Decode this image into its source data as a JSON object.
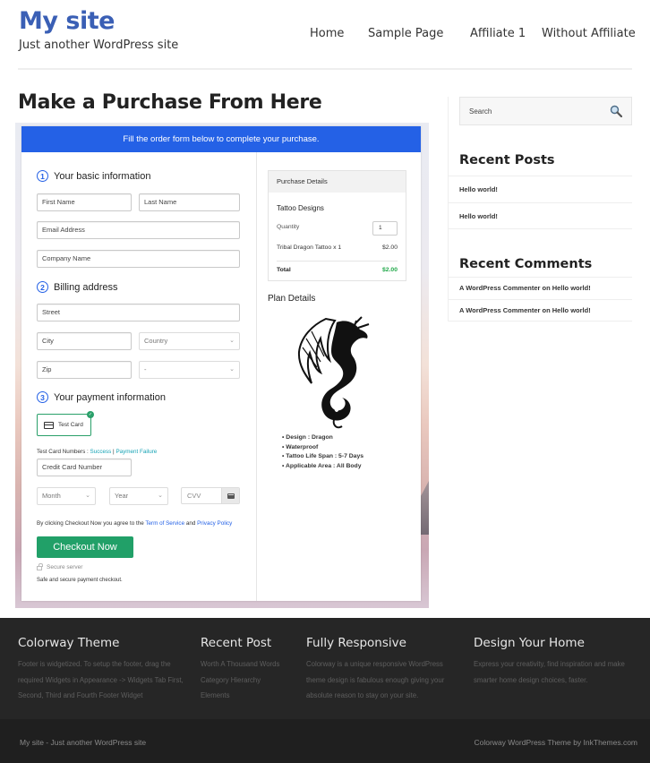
{
  "header": {
    "site_title": "My site",
    "site_description": "Just another WordPress site",
    "nav": [
      "Home",
      "Sample Page",
      "Affiliate 1",
      "Without Affiliate"
    ]
  },
  "page": {
    "title": "Make a Purchase From Here"
  },
  "form": {
    "banner": "Fill the order form below to complete your purchase.",
    "sections": [
      {
        "num": "1",
        "title": "Your basic information"
      },
      {
        "num": "2",
        "title": "Billing address"
      },
      {
        "num": "3",
        "title": "Your payment information"
      }
    ],
    "fields": {
      "first_name": "First Name",
      "last_name": "Last Name",
      "email": "Email Address",
      "company": "Company Name",
      "street": "Street",
      "city": "City",
      "country": "Country",
      "zip": "Zip",
      "state": "-",
      "card_number": "Credit Card Number",
      "month": "Month",
      "year": "Year",
      "cvv": "CVV"
    },
    "payment_method": "Test Card",
    "test_cards_label": "Test Card Numbers : ",
    "test_success": "Success",
    "test_sep": " | ",
    "test_failure": "Payment Failure",
    "agree_prefix": "By clicking Checkout Now you agree to the ",
    "terms": "Term of Service",
    "agree_and": " and ",
    "privacy": "Privacy Policy",
    "checkout_label": "Checkout Now",
    "secure_label": "Secure server",
    "safe_note": "Safe and secure payment checkout."
  },
  "purchase": {
    "heading": "Purchase Details",
    "product_group": "Tattoo Designs",
    "quantity_label": "Quantity",
    "quantity": "1",
    "line_item": "Tribal Dragon Tattoo x 1",
    "line_amount": "$2.00",
    "total_label": "Total",
    "total_amount": "$2.00"
  },
  "plan": {
    "heading": "Plan Details",
    "features": [
      "Design : Dragon",
      "Waterproof",
      "Tattoo Life Span : 5-7 Days",
      "Applicable Area : All Body"
    ]
  },
  "sidebar": {
    "search_placeholder": "Search",
    "recent_posts_title": "Recent Posts",
    "recent_posts": [
      "Hello world!",
      "Hello world!"
    ],
    "recent_comments_title": "Recent Comments",
    "recent_comments": [
      "A WordPress Commenter on Hello world!",
      "A WordPress Commenter on Hello world!"
    ]
  },
  "footer": {
    "columns": [
      {
        "title": "Colorway Theme",
        "text": "Footer is widgetized. To setup the footer, drag the required Widgets in Appearance -> Widgets Tab First, Second, Third and Fourth Footer Widget"
      },
      {
        "title": "Recent Post",
        "links": [
          "Worth A Thousand Words",
          "Category Hierarchy",
          "Elements"
        ]
      },
      {
        "title": "Fully Responsive",
        "text": "Colorway is a unique responsive WordPress theme design is fabulous enough giving your absolute reason to stay on your site."
      },
      {
        "title": "Design Your Home",
        "text": "Express your creativity, find inspiration and make smarter home design choices, faster."
      }
    ],
    "bottom_left": "My site - Just another WordPress site",
    "bottom_right": "Colorway WordPress Theme by InkThemes.com"
  },
  "colors": {
    "brand": "#3a5fb5",
    "banner": "#2461e6",
    "checkout": "#21a068",
    "total": "#21a84a",
    "footer_bg": "#262626"
  }
}
